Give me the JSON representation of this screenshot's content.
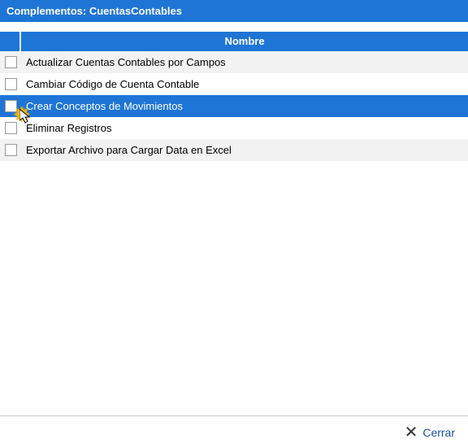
{
  "title": "Complementos: CuentasContables",
  "column_header": "Nombre",
  "items": [
    {
      "label": "Actualizar Cuentas Contables por Campos",
      "selected": false
    },
    {
      "label": "Cambiar Código de Cuenta Contable",
      "selected": false
    },
    {
      "label": "Crear Conceptos de Movimientos",
      "selected": true
    },
    {
      "label": "Eliminar Registros",
      "selected": false
    },
    {
      "label": "Exportar Archivo para Cargar Data en Excel",
      "selected": false
    }
  ],
  "close_label": "Cerrar"
}
